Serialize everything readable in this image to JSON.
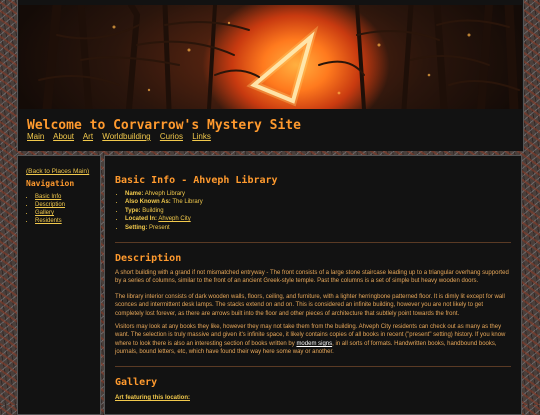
{
  "site": {
    "title": "Welcome to Corvarrow's Mystery Site",
    "nav": [
      "Main",
      "About",
      "Art",
      "Worldbuilding",
      "Curios",
      "Links"
    ]
  },
  "sidebar": {
    "back_link": "(Back to Places Main)",
    "heading": "Navigation",
    "items": [
      "Basic Info",
      "Description",
      "Gallery",
      "Residents"
    ]
  },
  "main": {
    "basic_info_heading": "Basic Info - Ahveph Library",
    "info": [
      {
        "label": "Name:",
        "value": "Ahveph Library"
      },
      {
        "label": "Also Known As:",
        "value": "The Library"
      },
      {
        "label": "Type:",
        "value": "Building"
      },
      {
        "label": "Located In:",
        "value": "Ahveph City"
      },
      {
        "label": "Setting:",
        "value": "Present"
      }
    ],
    "description_heading": "Description",
    "p1": "A short building with a grand if not mismatched entryway - The front consists of a large stone staircase leading up to a triangular overhang supported by a series of columns, similar to the front of an ancient Greek-style temple. Past the columns is a set of simple but heavy wooden doors.",
    "p2": "The library interior consists of dark wooden walls, floors, ceiling, and furniture, with a lighter herringbone patterned floor. It is dimly lit except for wall sconces and intermittent desk lamps. The stacks extend on and on. This is considered an infinite building, however you are not likely to get completely lost forever, as there are arrows built into the floor and other pieces of architecture that subtlely point towards the front.",
    "p3_before": "Visitors may look at any books they like, however they may not take them from the building. Ahveph City residents can check out as many as they want. The selection is truly massive and given it's infinite space, it likely contains copies of all books in recent (\"present\" setting) history. If you know where to look there is also an interesting section of books written by ",
    "p3_link": "modem signs",
    "p3_after": ", in all sorts of formats. Handwritten books, handbound books, journals, bound letters, etc, which have found their way here some way or another.",
    "gallery_heading": "Gallery",
    "gallery_link": "Art featuring this location:"
  },
  "colors": {
    "accent_orange": "#ff9a2e",
    "link_yellow": "#f2c94c",
    "panel_bg": "#121212"
  }
}
